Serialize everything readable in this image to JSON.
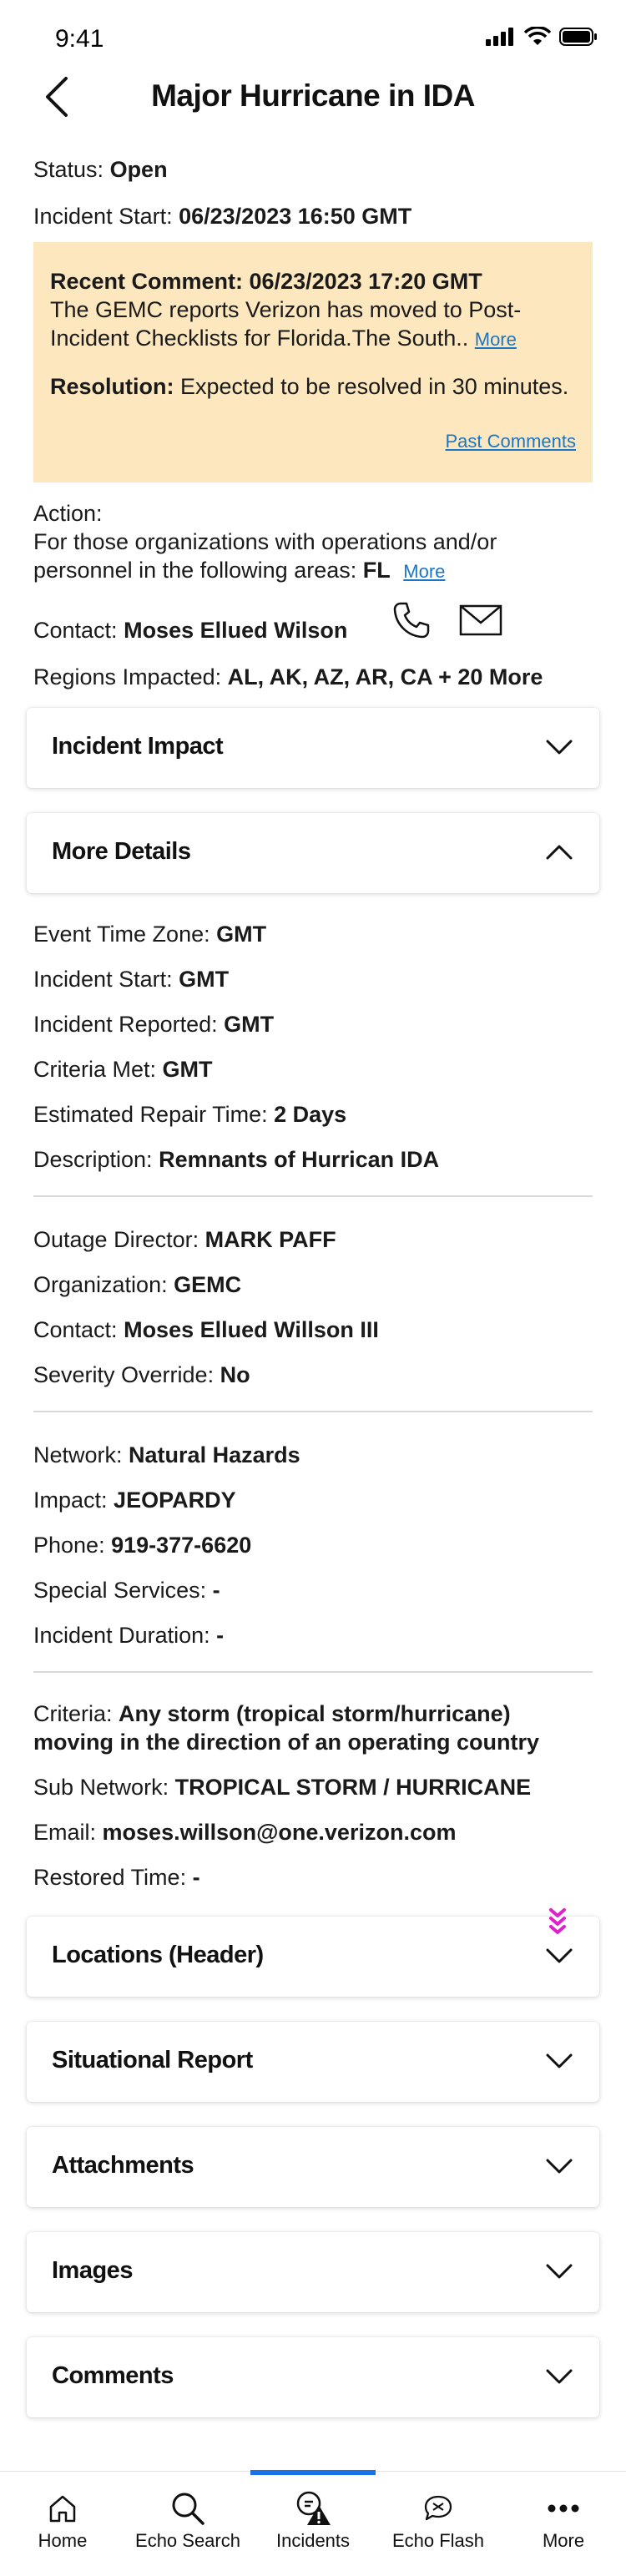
{
  "status_bar": {
    "time": "9:41"
  },
  "header": {
    "title": "Major Hurricane in IDA"
  },
  "summary": {
    "status_label": "Status:",
    "status_value": "Open",
    "start_label": "Incident Start:",
    "start_value": "06/23/2023 16:50 GMT"
  },
  "recent_comment": {
    "title": "Recent Comment: 06/23/2023 17:20 GMT",
    "text": "The GEMC reports Verizon has moved to Post-Incident Checklists for Florida.The South..",
    "more_link": "More",
    "resolution_label": "Resolution:",
    "resolution_text": "Expected to be resolved in 30 minutes.",
    "past_comments_link": "Past Comments"
  },
  "action": {
    "label": "Action:",
    "text": "For those organizations with operations and/or personnel in the following areas:",
    "area": "FL",
    "more_link": "More"
  },
  "contact": {
    "label": "Contact:",
    "value": "Moses Ellued Wilson"
  },
  "regions": {
    "label": "Regions Impacted:",
    "value": "AL, AK, AZ, AR, CA + 20 More"
  },
  "sections": {
    "incident_impact": "Incident Impact",
    "more_details": "More Details",
    "locations": "Locations (Header)",
    "situational_report": "Situational Report",
    "attachments": "Attachments",
    "images": "Images",
    "comments": "Comments"
  },
  "details": {
    "group1": [
      {
        "label": "Event Time Zone:",
        "value": "GMT"
      },
      {
        "label": "Incident Start:",
        "value": "GMT"
      },
      {
        "label": "Incident Reported:",
        "value": "GMT"
      },
      {
        "label": "Criteria Met:",
        "value": "GMT"
      },
      {
        "label": "Estimated Repair Time:",
        "value": "2 Days"
      },
      {
        "label": "Description:",
        "value": "Remnants of Hurrican IDA"
      }
    ],
    "group2": [
      {
        "label": "Outage Director:",
        "value": "MARK PAFF"
      },
      {
        "label": "Organization:",
        "value": "GEMC"
      },
      {
        "label": "Contact:",
        "value": "Moses Ellued Willson III"
      },
      {
        "label": "Severity Override:",
        "value": "No"
      }
    ],
    "group3": [
      {
        "label": "Network:",
        "value": "Natural Hazards"
      },
      {
        "label": "Impact:",
        "value": "JEOPARDY"
      },
      {
        "label": "Phone:",
        "value": "919-377-6620"
      },
      {
        "label": "Special Services:",
        "value": "-"
      },
      {
        "label": "Incident Duration:",
        "value": "-"
      }
    ],
    "group4": {
      "criteria_label": "Criteria:",
      "criteria_value_line1": "Any storm (tropical storm/hurricane)",
      "criteria_value_line2": "moving in the direction of an operating country",
      "rows": [
        {
          "label": "Sub Network:",
          "value": "TROPICAL STORM / HURRICANE"
        },
        {
          "label": "Email:",
          "value": "moses.willson@one.verizon.com"
        },
        {
          "label": "Restored Time:",
          "value": "-"
        }
      ]
    }
  },
  "tabbar": {
    "tabs": [
      {
        "label": "Home",
        "icon": "home-icon"
      },
      {
        "label": "Echo Search",
        "icon": "search-icon"
      },
      {
        "label": "Incidents",
        "icon": "incident-alert-icon"
      },
      {
        "label": "Echo Flash",
        "icon": "flash-chat-icon"
      },
      {
        "label": "More",
        "icon": "more-icon"
      }
    ],
    "active_index": 2
  },
  "colors": {
    "comment_bg": "#fde7be",
    "link": "#1a76c6",
    "tab_active": "#1a73e8",
    "scroll_hint": "#e020c8"
  }
}
